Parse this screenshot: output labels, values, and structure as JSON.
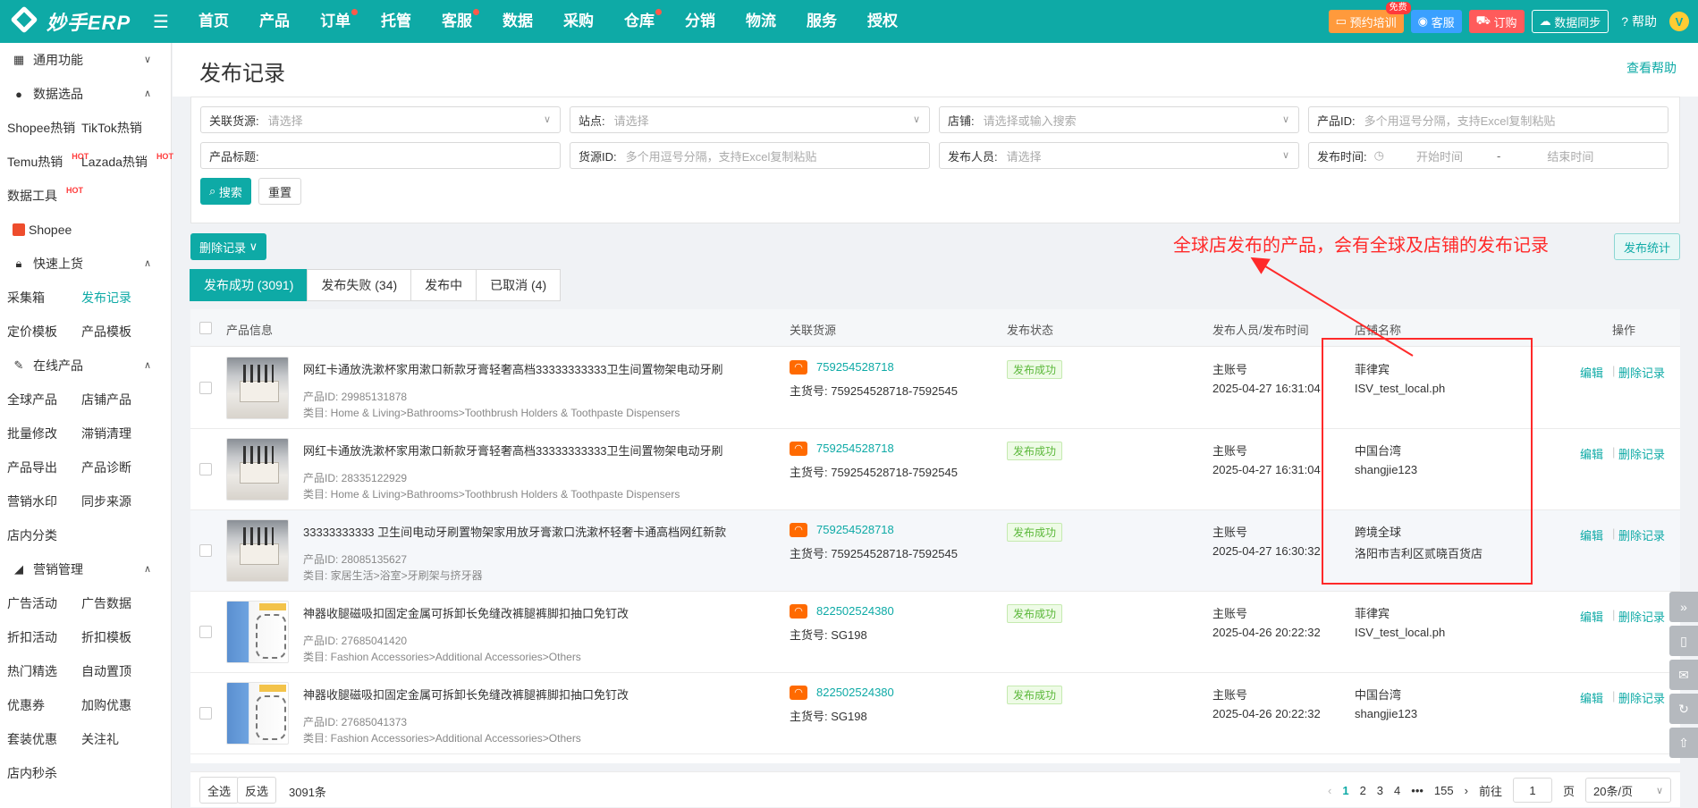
{
  "app": {
    "logo_text": "妙手ERP"
  },
  "nav": [
    "首页",
    "产品",
    "订单",
    "托管",
    "客服",
    "数据",
    "采购",
    "仓库",
    "分销",
    "物流",
    "服务",
    "授权"
  ],
  "topbar": {
    "training": "预约培训",
    "training_badge": "免费",
    "service": "客服",
    "order": "订购",
    "sync": "数据同步",
    "help": "帮助",
    "avatar": "V"
  },
  "sidebar": {
    "general": "通用功能",
    "data_select": "数据选品",
    "shopee_hot": "Shopee热销",
    "tiktok_hot": "TikTok热销",
    "temu_hot": "Temu热销",
    "lazada_hot": "Lazada热销",
    "data_tool": "数据工具",
    "hot": "HOT",
    "shopee": "Shopee",
    "quick_upload": "快速上货",
    "collect_box": "采集箱",
    "publish_record": "发布记录",
    "price_tpl": "定价模板",
    "product_tpl": "产品模板",
    "online_products": "在线产品",
    "global_products": "全球产品",
    "store_products": "店铺产品",
    "batch_edit": "批量修改",
    "slow_clear": "滞销清理",
    "product_export": "产品导出",
    "product_diag": "产品诊断",
    "watermark": "营销水印",
    "sync_source": "同步来源",
    "store_category": "店内分类",
    "marketing": "营销管理",
    "ad_activity": "广告活动",
    "ad_data": "广告数据",
    "discount_activity": "折扣活动",
    "discount_tpl": "折扣模板",
    "hot_pick": "热门精选",
    "auto_top": "自动置顶",
    "coupon": "优惠券",
    "addon_deal": "加购优惠",
    "bundle_deal": "套装优惠",
    "follow_gift": "关注礼",
    "flash_sale": "店内秒杀"
  },
  "page": {
    "title": "发布记录",
    "help_link": "查看帮助"
  },
  "filters": {
    "source_label": "关联货源:",
    "source_ph": "请选择",
    "site_label": "站点:",
    "site_ph": "请选择",
    "store_label": "店铺:",
    "store_ph": "请选择或输入搜索",
    "pid_label": "产品ID:",
    "pid_ph": "多个用逗号分隔，支持Excel复制粘贴",
    "title_label": "产品标题:",
    "srcid_label": "货源ID:",
    "srcid_ph": "多个用逗号分隔，支持Excel复制粘贴",
    "publisher_label": "发布人员:",
    "publisher_ph": "请选择",
    "time_label": "发布时间:",
    "start_ph": "开始时间",
    "dash": "-",
    "end_ph": "结束时间",
    "search_btn": "搜索",
    "reset_btn": "重置"
  },
  "actions": {
    "delete_records": "删除记录",
    "publish_stats": "发布统计"
  },
  "annotation": "全球店发布的产品，会有全球及店铺的发布记录",
  "tabs": [
    "发布成功 (3091)",
    "发布失败 (34)",
    "发布中",
    "已取消 (4)"
  ],
  "table": {
    "headers": {
      "product": "产品信息",
      "source": "关联货源",
      "status": "发布状态",
      "publisher": "发布人员/发布时间",
      "store": "店铺名称",
      "op": "操作"
    },
    "rows": [
      {
        "title": "网红卡通放洗漱杯家用漱口新款牙膏轻奢高档33333333333卫生间置物架电动牙刷",
        "pid": "产品ID: 29985131878",
        "cat": "类目: Home & Living>Bathrooms>Toothbrush Holders & Toothpaste Dispensers",
        "src_id": "759254528718",
        "src_main": "主货号: 759254528718-7592545",
        "status": "发布成功",
        "publisher": "主账号",
        "time": "2025-04-27 16:31:04",
        "site": "菲律宾",
        "shop": "ISV_test_local.ph",
        "thumb": "holder"
      },
      {
        "title": "网红卡通放洗漱杯家用漱口新款牙膏轻奢高档33333333333卫生间置物架电动牙刷",
        "pid": "产品ID: 28335122929",
        "cat": "类目: Home & Living>Bathrooms>Toothbrush Holders & Toothpaste Dispensers",
        "src_id": "759254528718",
        "src_main": "主货号: 759254528718-7592545",
        "status": "发布成功",
        "publisher": "主账号",
        "time": "2025-04-27 16:31:04",
        "site": "中国台湾",
        "shop": "shangjie123",
        "thumb": "holder"
      },
      {
        "title": "33333333333 卫生间电动牙刷置物架家用放牙膏漱口洗漱杯轻奢卡通高档网红新款",
        "pid": "产品ID: 28085135627",
        "cat": "类目: 家居生活>浴室>牙刷架与挤牙器",
        "src_id": "759254528718",
        "src_main": "主货号: 759254528718-7592545",
        "status": "发布成功",
        "publisher": "主账号",
        "time": "2025-04-27 16:30:32",
        "site": "跨境全球",
        "shop": "洛阳市吉利区贰晓百货店",
        "thumb": "holder"
      },
      {
        "title": "神器收腿磁吸扣固定金属可拆卸长免缝改裤腿裤脚扣抽口免钉改",
        "pid": "产品ID: 27685041420",
        "cat": "类目: Fashion Accessories>Additional Accessories>Others",
        "src_id": "822502524380",
        "src_main": "主货号: SG198",
        "status": "发布成功",
        "publisher": "主账号",
        "time": "2025-04-26 20:22:32",
        "site": "菲律宾",
        "shop": "ISV_test_local.ph",
        "thumb": "clip"
      },
      {
        "title": "神器收腿磁吸扣固定金属可拆卸长免缝改裤腿裤脚扣抽口免钉改",
        "pid": "产品ID: 27685041373",
        "cat": "类目: Fashion Accessories>Additional Accessories>Others",
        "src_id": "822502524380",
        "src_main": "主货号: SG198",
        "status": "发布成功",
        "publisher": "主账号",
        "time": "2025-04-26 20:22:32",
        "site": "中国台湾",
        "shop": "shangjie123",
        "thumb": "clip"
      }
    ],
    "edit": "编辑",
    "delete": "删除记录"
  },
  "footer": {
    "select_all": "全选",
    "invert": "反选",
    "count": "3091条",
    "pages": [
      "1",
      "2",
      "3",
      "4"
    ],
    "ellipsis": "•••",
    "last_page": "155",
    "goto": "前往",
    "page_input": "1",
    "page_unit": "页",
    "page_size": "20条/页"
  }
}
